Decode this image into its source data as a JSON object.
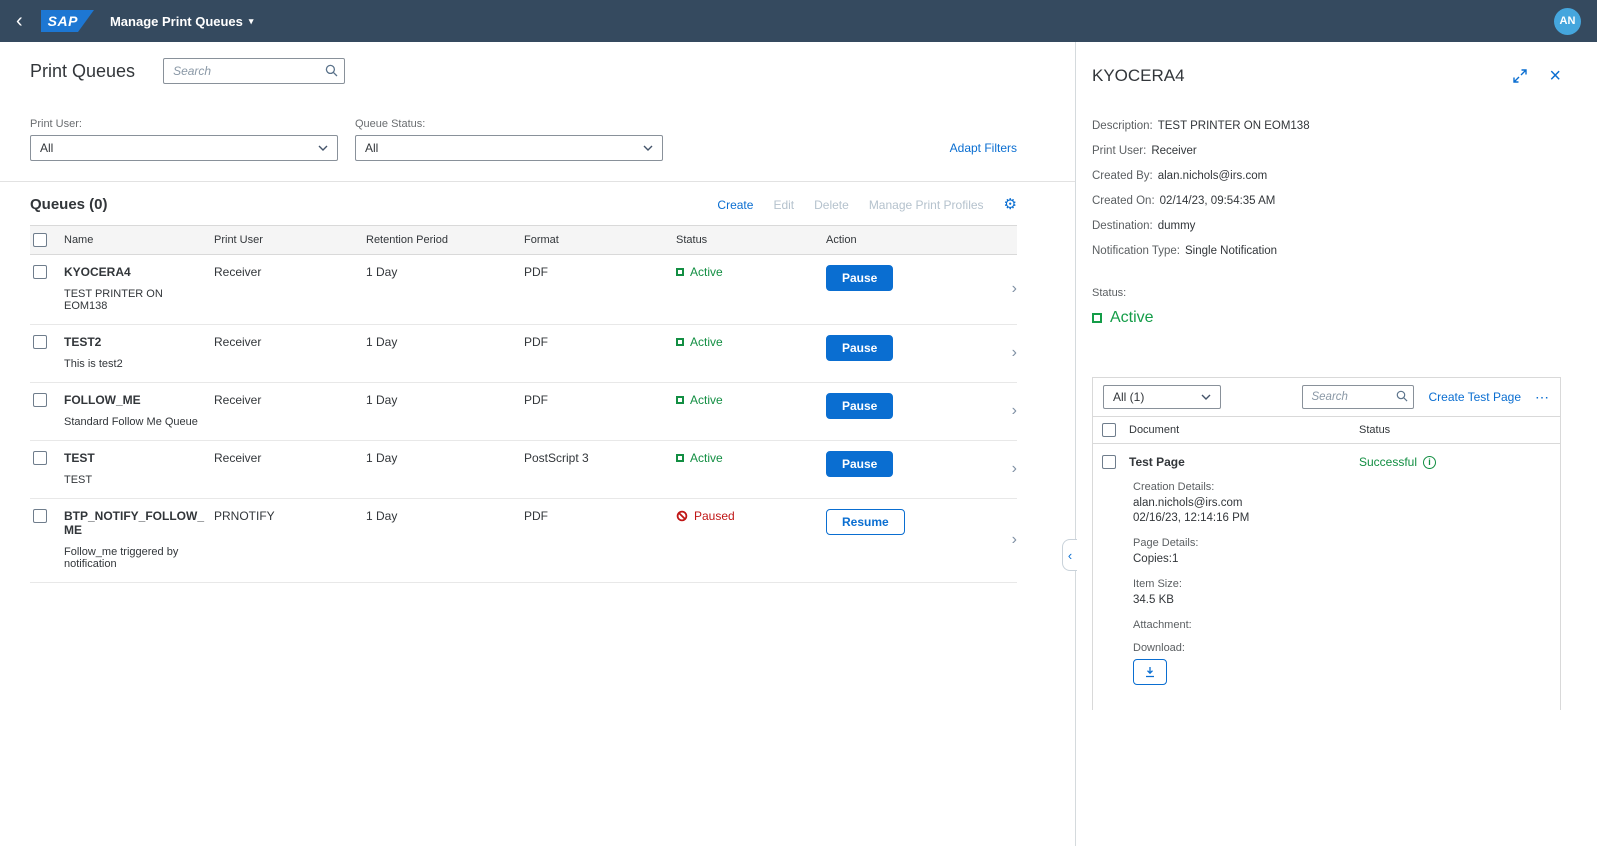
{
  "colors": {
    "accent": "#0a6ed1",
    "active_green": "#128e42",
    "paused_red": "#c01616",
    "shell": "#354a5f"
  },
  "icons": {
    "back": "‹",
    "caret_down": "▾",
    "chevron_right": "›",
    "collapse": "‹",
    "overflow": "⋯",
    "gear": "⚙"
  },
  "shellbar": {
    "logo": "SAP",
    "title": "Manage Print Queues",
    "avatar": "AN"
  },
  "page": {
    "title": "Print Queues",
    "search_placeholder": "Search"
  },
  "filters": {
    "print_user_label": "Print User:",
    "print_user_value": "All",
    "queue_status_label": "Queue Status:",
    "queue_status_value": "All",
    "adapt_filters_label": "Adapt Filters"
  },
  "queues": {
    "title": "Queues (0)",
    "toolbar": {
      "create": "Create",
      "edit": "Edit",
      "delete": "Delete",
      "manage_profiles": "Manage Print Profiles"
    },
    "columns": {
      "name": "Name",
      "print_user": "Print User",
      "retention": "Retention Period",
      "format": "Format",
      "status": "Status",
      "action": "Action"
    },
    "rows": [
      {
        "name": "KYOCERA4",
        "description": "TEST PRINTER ON EOM138",
        "print_user": "Receiver",
        "retention": "1 Day",
        "format": "PDF",
        "status": "Active",
        "status_state": "active",
        "action": "Pause"
      },
      {
        "name": "TEST2",
        "description": "This is test2",
        "print_user": "Receiver",
        "retention": "1 Day",
        "format": "PDF",
        "status": "Active",
        "status_state": "active",
        "action": "Pause"
      },
      {
        "name": "FOLLOW_ME",
        "description": "Standard Follow Me Queue",
        "print_user": "Receiver",
        "retention": "1 Day",
        "format": "PDF",
        "status": "Active",
        "status_state": "active",
        "action": "Pause"
      },
      {
        "name": "TEST",
        "description": "TEST",
        "print_user": "Receiver",
        "retention": "1 Day",
        "format": "PostScript 3",
        "status": "Active",
        "status_state": "active",
        "action": "Pause"
      },
      {
        "name": "BTP_NOTIFY_FOLLOW_ME",
        "description": "Follow_me triggered by notification",
        "print_user": "PRNOTIFY",
        "retention": "1 Day",
        "format": "PDF",
        "status": "Paused",
        "status_state": "paused",
        "action": "Resume"
      }
    ]
  },
  "detail": {
    "title": "KYOCERA4",
    "fields": [
      {
        "label": "Description:",
        "value": "TEST PRINTER ON EOM138"
      },
      {
        "label": "Print User:",
        "value": "Receiver"
      },
      {
        "label": "Created By:",
        "value": "alan.nichols@irs.com"
      },
      {
        "label": "Created On:",
        "value": "02/14/23, 09:54:35 AM"
      },
      {
        "label": "Destination:",
        "value": "dummy"
      },
      {
        "label": "Notification Type:",
        "value": "Single Notification"
      }
    ],
    "status_label": "Status:",
    "status_value": "Active",
    "documents": {
      "filter_value": "All (1)",
      "search_placeholder": "Search",
      "create_test_page_label": "Create Test Page",
      "columns": {
        "document": "Document",
        "status": "Status"
      },
      "row": {
        "name": "Test Page",
        "status": "Successful"
      },
      "details": [
        {
          "label": "Creation Details:",
          "values": [
            "alan.nichols@irs.com",
            "02/16/23, 12:14:16 PM"
          ]
        },
        {
          "label": "Page Details:",
          "values": [
            "Copies:1"
          ]
        },
        {
          "label": "Item Size:",
          "values": [
            "34.5 KB"
          ]
        },
        {
          "label": "Attachment:",
          "values": []
        },
        {
          "label": "Download:",
          "values": []
        }
      ]
    }
  }
}
